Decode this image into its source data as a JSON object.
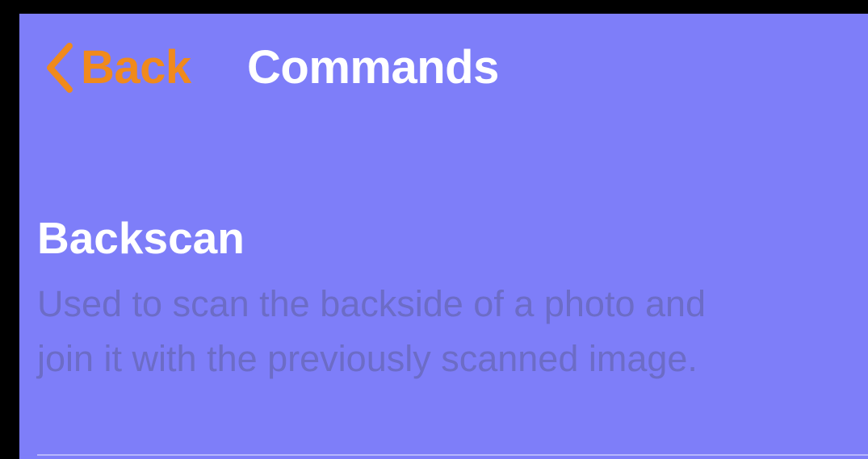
{
  "nav": {
    "back_label": "Back",
    "back_icon": "chevron-left-icon",
    "title": "Commands"
  },
  "commands": [
    {
      "title": "Backscan",
      "description": "Used to scan the backside of a photo and join it with the previously scanned image."
    }
  ],
  "colors": {
    "background": "#7e7ef9",
    "accent": "#f08a1c",
    "title_text": "#ffffff",
    "description_text": "#6c6cc6",
    "frame": "#000000"
  }
}
